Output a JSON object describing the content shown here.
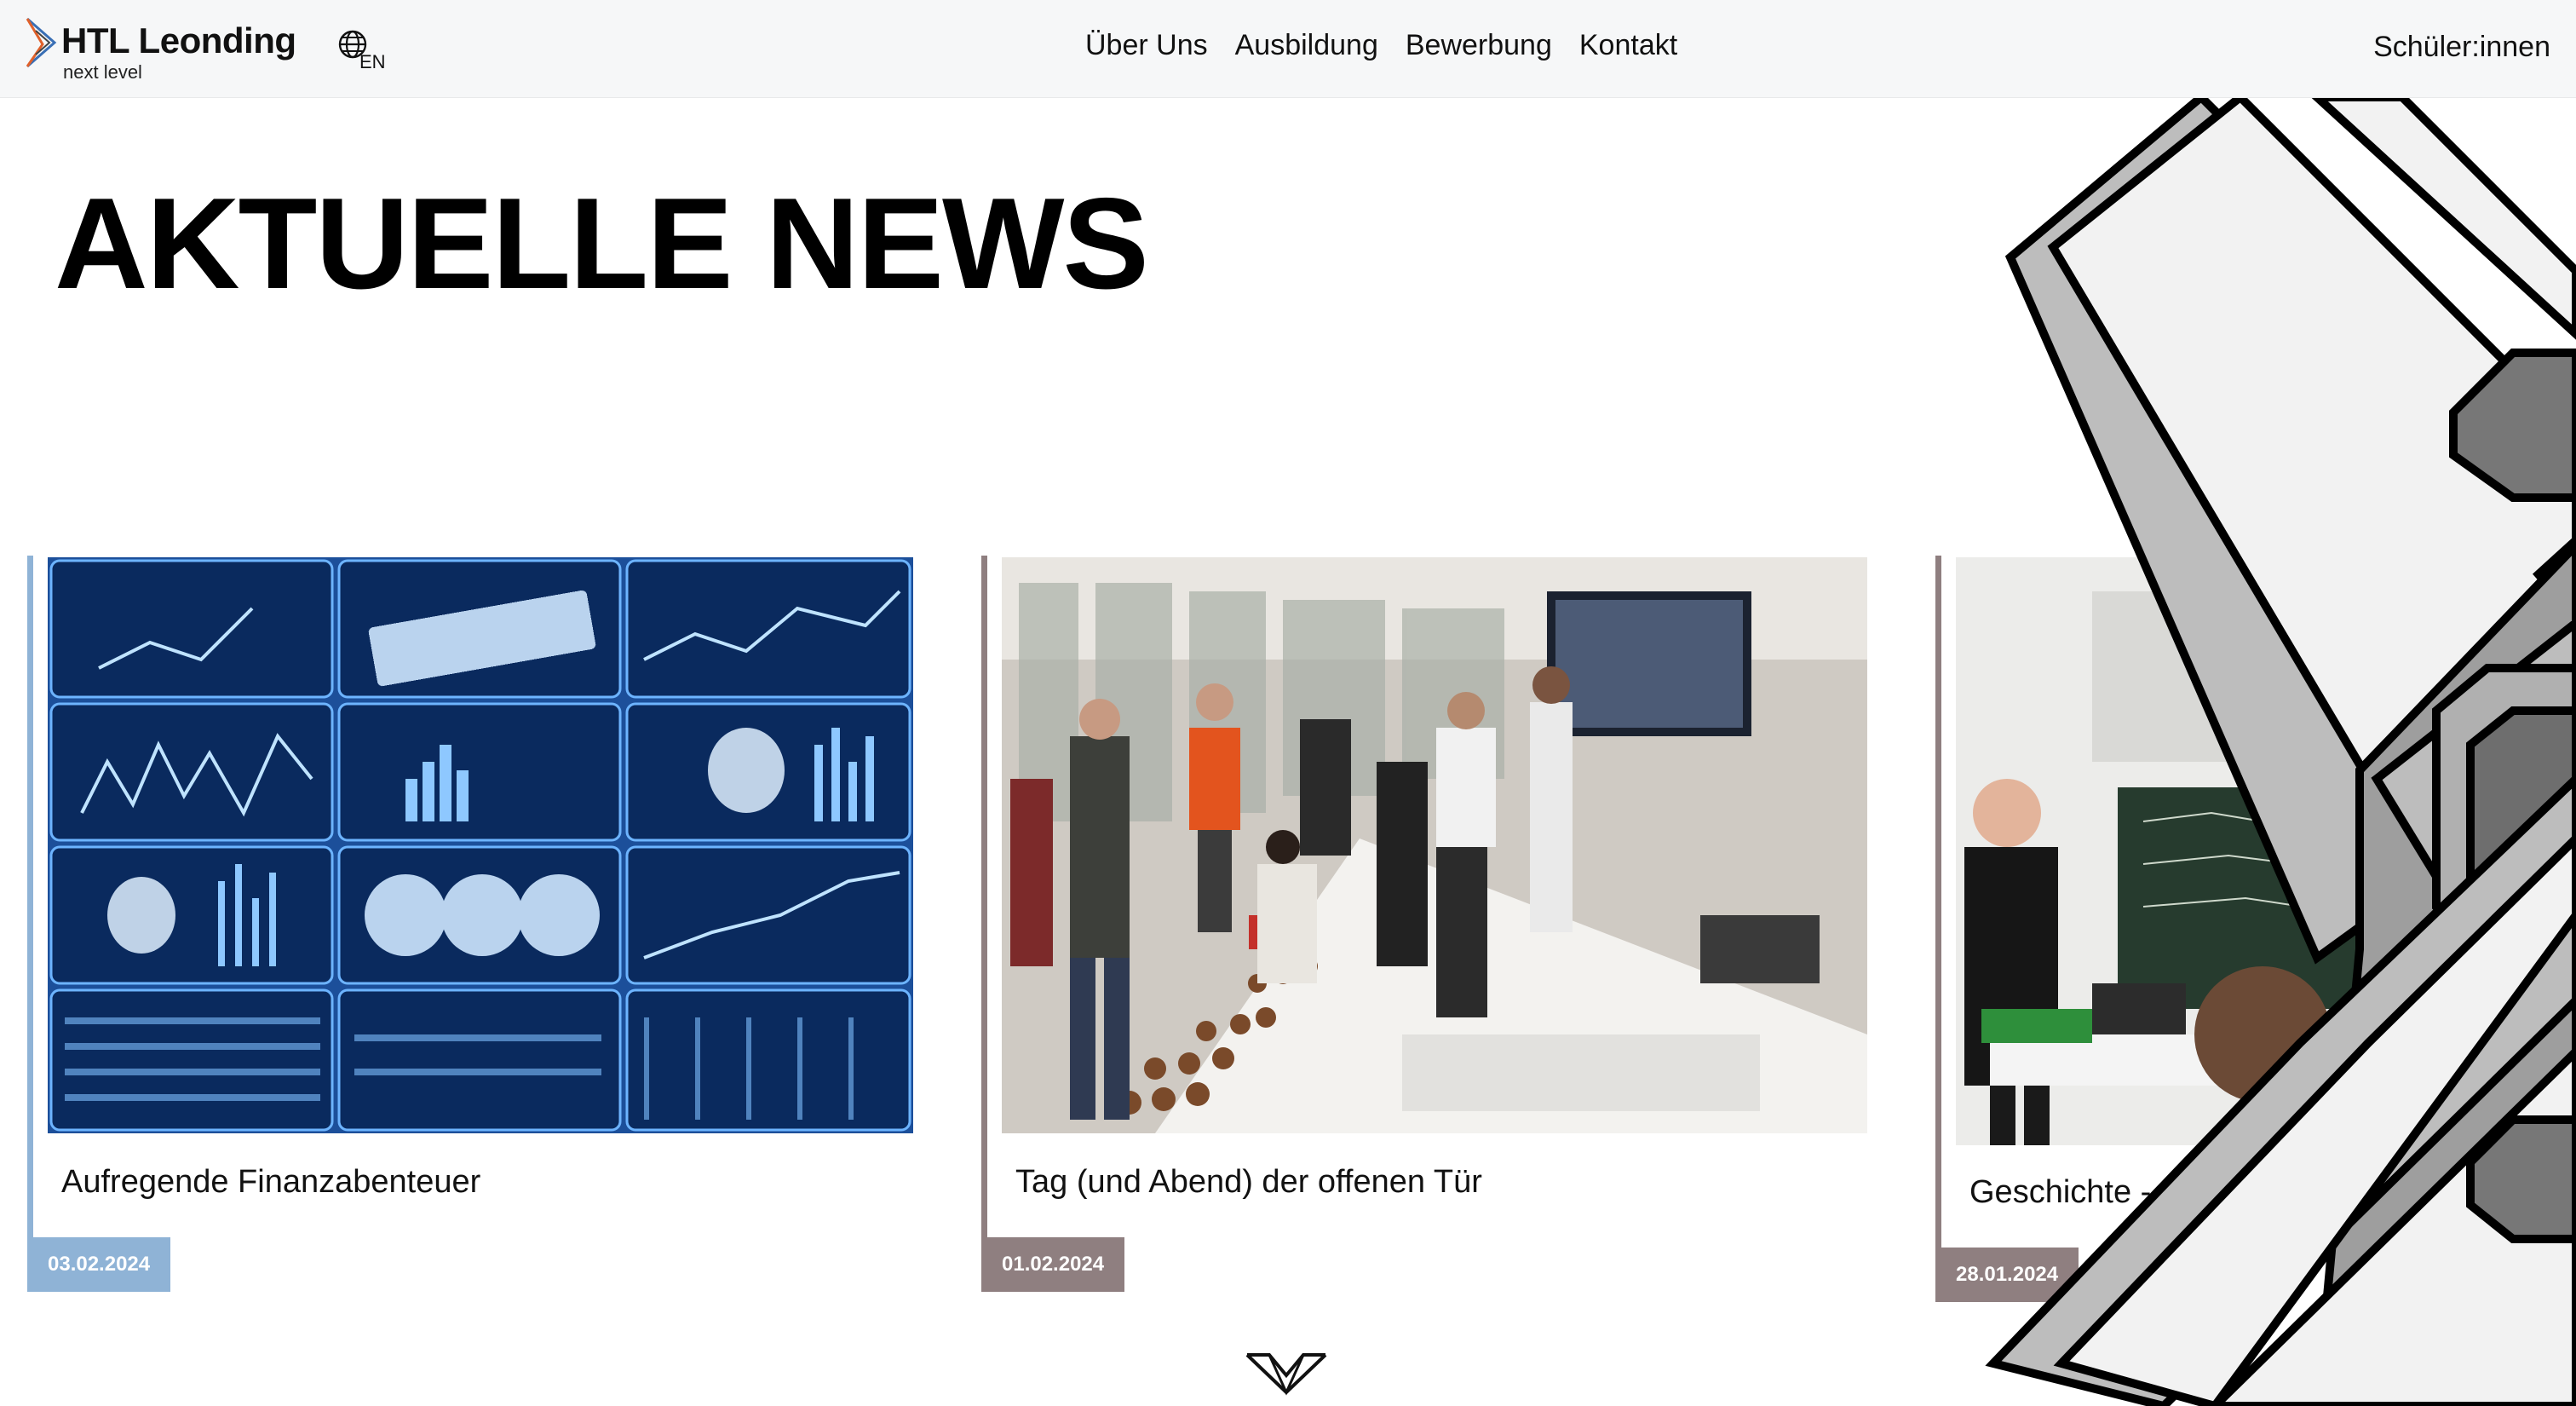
{
  "header": {
    "logo_title": "HTL Leonding",
    "logo_subtitle": "next level",
    "language_code": "EN",
    "nav": [
      "Über Uns",
      "Ausbildung",
      "Bewerbung",
      "Kontakt"
    ],
    "students_link": "Schüler:innen"
  },
  "main": {
    "headline": "AKTUELLE NEWS"
  },
  "news": [
    {
      "title": "Aufregende Finanzabenteuer",
      "date": "03.02.2024",
      "accent": "#8fb3d6",
      "image": "finance-screens-photo"
    },
    {
      "title": "Tag (und Abend) der offenen Tür",
      "date": "01.02.2024",
      "accent": "#8f7f80",
      "image": "open-day-buffet-photo"
    },
    {
      "title": "Geschichte - ...",
      "date": "28.01.2024",
      "accent": "#8f7f80",
      "image": "classroom-presentation-photo"
    }
  ],
  "icons": {
    "language": "globe-icon",
    "scroll": "chevron-down-icon",
    "logo": "htl-logo-icon"
  }
}
